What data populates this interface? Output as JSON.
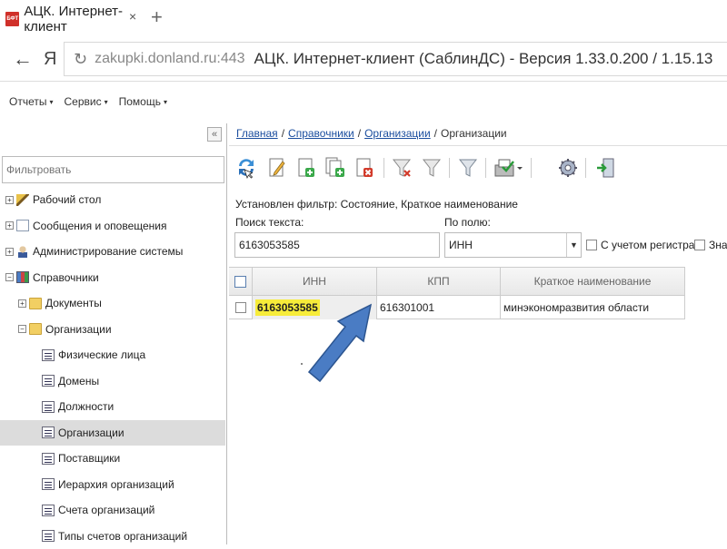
{
  "browser": {
    "tab_title": "АЦК. Интернет-клиент",
    "tab_close": "×",
    "new_tab": "+",
    "favicon_text": "БФТ",
    "back_glyph": "←",
    "ya_logo": "Я",
    "reload_glyph": "↻",
    "url": "zakupki.donland.ru:443",
    "page_title": "АЦК. Интернет-клиент (СаблинДС) - Версия 1.33.0.200 / 1.15.13"
  },
  "menu": [
    {
      "label": "Отчеты"
    },
    {
      "label": "Сервис"
    },
    {
      "label": "Помощь"
    }
  ],
  "menu_caret": "▾",
  "sidebar": {
    "collapse_glyph": "«",
    "filter_placeholder": "Фильтровать",
    "tree": [
      {
        "label": "Рабочий стол",
        "level": 0,
        "expander": "+",
        "icon": "broom-icon"
      },
      {
        "label": "Сообщения и оповещения",
        "level": 0,
        "expander": "+",
        "icon": "envelope-icon"
      },
      {
        "label": "Администрирование системы",
        "level": 0,
        "expander": "+",
        "icon": "admin-user-icon"
      },
      {
        "label": "Справочники",
        "level": 0,
        "expander": "−",
        "icon": "books-icon"
      },
      {
        "label": "Документы",
        "level": 1,
        "expander": "+",
        "icon": "folder-icon"
      },
      {
        "label": "Организации",
        "level": 1,
        "expander": "−",
        "icon": "folder-icon"
      },
      {
        "label": "Физические лица",
        "level": 2,
        "expander": "",
        "icon": "list-icon"
      },
      {
        "label": "Домены",
        "level": 2,
        "expander": "",
        "icon": "list-icon"
      },
      {
        "label": "Должности",
        "level": 2,
        "expander": "",
        "icon": "list-icon"
      },
      {
        "label": "Организации",
        "level": 2,
        "expander": "",
        "icon": "list-icon",
        "selected": true
      },
      {
        "label": "Поставщики",
        "level": 2,
        "expander": "",
        "icon": "list-icon"
      },
      {
        "label": "Иерархия организаций",
        "level": 2,
        "expander": "",
        "icon": "list-icon"
      },
      {
        "label": "Счета организаций",
        "level": 2,
        "expander": "",
        "icon": "list-icon"
      },
      {
        "label": "Типы счетов организаций",
        "level": 2,
        "expander": "",
        "icon": "list-icon"
      }
    ]
  },
  "breadcrumb": {
    "items": [
      "Главная",
      "Справочники",
      "Организации"
    ],
    "current": "Организации",
    "separator": "/"
  },
  "toolbar_icons": [
    "refresh-icon",
    "edit-icon",
    "add-document-icon",
    "copy-document-icon",
    "delete-document-icon",
    "filter-clear-icon",
    "filter-icon",
    "filter-settings-icon",
    "export-icon",
    "settings-gear-icon",
    "exit-icon"
  ],
  "filter": {
    "info": "Установлен фильтр: Состояние, Краткое наименование",
    "search_label": "Поиск текста:",
    "search_value": "6163053585",
    "field_label": "По полю:",
    "field_value": "ИНН",
    "dropdown_glyph": "▼",
    "case_label": "С учетом регистра",
    "mean_label": "Знач"
  },
  "grid": {
    "columns": [
      "ИНН",
      "КПП",
      "Краткое наименование"
    ],
    "rows": [
      {
        "inn": "6163053585",
        "kpp": "616301001",
        "name": "минэкономразвития области"
      }
    ]
  },
  "colors": {
    "highlight": "#f7ec3a",
    "arrow": "#4a7cc4",
    "link": "#1a4d9e"
  }
}
